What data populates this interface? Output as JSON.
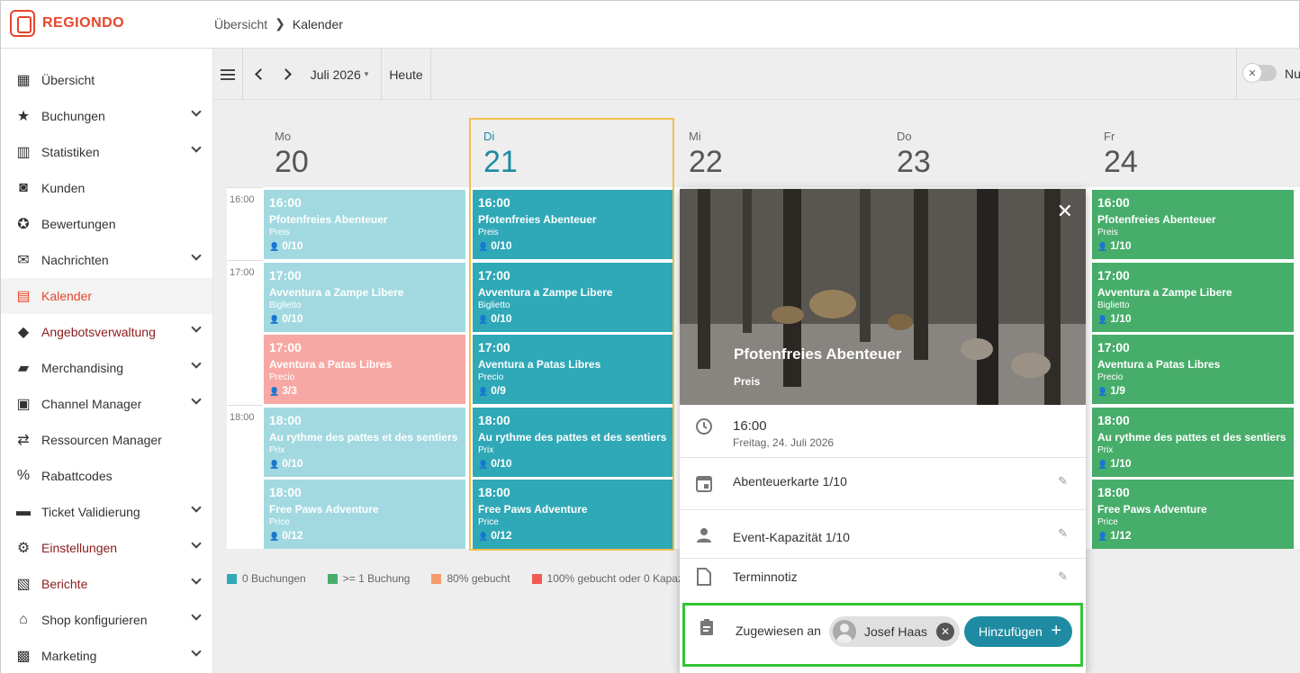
{
  "brand": {
    "name": "REGIONDO",
    "color": "#e8452c"
  },
  "breadcrumb": {
    "root": "Übersicht",
    "current": "Kalender"
  },
  "sidebar": {
    "items": [
      {
        "label": "Übersicht",
        "icon": "dashboard-icon",
        "glyph": "▦",
        "chevron": false,
        "state": ""
      },
      {
        "label": "Buchungen",
        "icon": "ticket-star-icon",
        "glyph": "★",
        "chevron": true,
        "state": ""
      },
      {
        "label": "Statistiken",
        "icon": "bar-chart-icon",
        "glyph": "▥",
        "chevron": true,
        "state": ""
      },
      {
        "label": "Kunden",
        "icon": "customer-icon",
        "glyph": "◙",
        "chevron": false,
        "state": ""
      },
      {
        "label": "Bewertungen",
        "icon": "star-badge-icon",
        "glyph": "✪",
        "chevron": false,
        "state": ""
      },
      {
        "label": "Nachrichten",
        "icon": "envelope-icon",
        "glyph": "✉",
        "chevron": true,
        "state": ""
      },
      {
        "label": "Kalender",
        "icon": "calendar-icon",
        "glyph": "▤",
        "chevron": false,
        "state": "active"
      },
      {
        "label": "Angebotsverwaltung",
        "icon": "tag-icon",
        "glyph": "◆",
        "chevron": true,
        "state": "red"
      },
      {
        "label": "Merchandising",
        "icon": "shopping-bag-icon",
        "glyph": "▰",
        "chevron": true,
        "state": ""
      },
      {
        "label": "Channel Manager",
        "icon": "channel-icon",
        "glyph": "▣",
        "chevron": true,
        "state": ""
      },
      {
        "label": "Ressourcen Manager",
        "icon": "sync-icon",
        "glyph": "⇄",
        "chevron": false,
        "state": ""
      },
      {
        "label": "Rabattcodes",
        "icon": "percent-icon",
        "glyph": "%",
        "chevron": false,
        "state": ""
      },
      {
        "label": "Ticket Validierung",
        "icon": "ticket-icon",
        "glyph": "▬",
        "chevron": true,
        "state": ""
      },
      {
        "label": "Einstellungen",
        "icon": "gear-icon",
        "glyph": "⚙",
        "chevron": true,
        "state": "red"
      },
      {
        "label": "Berichte",
        "icon": "report-icon",
        "glyph": "▧",
        "chevron": true,
        "state": "red"
      },
      {
        "label": "Shop konfigurieren",
        "icon": "store-icon",
        "glyph": "⌂",
        "chevron": true,
        "state": ""
      },
      {
        "label": "Marketing",
        "icon": "marketing-icon",
        "glyph": "▩",
        "chevron": true,
        "state": ""
      }
    ]
  },
  "toolbar": {
    "month": "Juli 2026",
    "today": "Heute",
    "toggle_label": "Nu"
  },
  "days": [
    {
      "name": "Mo",
      "num": "20",
      "today": false
    },
    {
      "name": "Di",
      "num": "21",
      "today": true
    },
    {
      "name": "Mi",
      "num": "22",
      "today": false
    },
    {
      "name": "Do",
      "num": "23",
      "today": false
    },
    {
      "name": "Fr",
      "num": "24",
      "today": false
    }
  ],
  "time_labels": [
    "16:00",
    "17:00",
    "18:00"
  ],
  "events": {
    "mo": [
      {
        "time": "16:00",
        "name": "Pfotenfreies Abenteuer",
        "price": "Preis",
        "cap": "0/10",
        "style": "light"
      },
      {
        "time": "17:00",
        "name": "Avventura a Zampe Libere",
        "price": "Biglietto",
        "cap": "0/10",
        "style": "light"
      },
      {
        "time": "17:00",
        "name": "Aventura a Patas Libres",
        "price": "Precio",
        "cap": "3/3",
        "style": "red"
      },
      {
        "time": "18:00",
        "name": "Au rythme des pattes et des sentiers",
        "price": "Prix",
        "cap": "0/10",
        "style": "light"
      },
      {
        "time": "18:00",
        "name": "Free Paws Adventure",
        "price": "Price",
        "cap": "0/12",
        "style": "light"
      }
    ],
    "di": [
      {
        "time": "16:00",
        "name": "Pfotenfreies Abenteuer",
        "price": "Preis",
        "cap": "0/10",
        "style": "dark"
      },
      {
        "time": "17:00",
        "name": "Avventura a Zampe Libere",
        "price": "Biglietto",
        "cap": "0/10",
        "style": "dark"
      },
      {
        "time": "17:00",
        "name": "Aventura a Patas Libres",
        "price": "Precio",
        "cap": "0/9",
        "style": "dark"
      },
      {
        "time": "18:00",
        "name": "Au rythme des pattes et des sentiers",
        "price": "Prix",
        "cap": "0/10",
        "style": "dark"
      },
      {
        "time": "18:00",
        "name": "Free Paws Adventure",
        "price": "Price",
        "cap": "0/12",
        "style": "dark"
      }
    ],
    "fr": [
      {
        "time": "16:00",
        "name": "Pfotenfreies Abenteuer",
        "price": "Preis",
        "cap": "1/10",
        "style": "green"
      },
      {
        "time": "17:00",
        "name": "Avventura a Zampe Libere",
        "price": "Biglietto",
        "cap": "1/10",
        "style": "green"
      },
      {
        "time": "17:00",
        "name": "Aventura a Patas Libres",
        "price": "Precio",
        "cap": "1/9",
        "style": "green"
      },
      {
        "time": "18:00",
        "name": "Au rythme des pattes et des sentiers",
        "price": "Prix",
        "cap": "1/10",
        "style": "green"
      },
      {
        "time": "18:00",
        "name": "Free Paws Adventure",
        "price": "Price",
        "cap": "1/12",
        "style": "green"
      }
    ]
  },
  "legend": [
    {
      "label": "0 Buchungen",
      "color": "#2fa8b7"
    },
    {
      "label": ">= 1 Buchung",
      "color": "#47ad6a"
    },
    {
      "label": "80% gebucht",
      "color": "#f59b6a"
    },
    {
      "label": "100% gebucht oder 0 Kapaz",
      "color": "#ef5a50"
    }
  ],
  "popup": {
    "title": "Pfotenfreies Abenteuer",
    "subtitle": "Preis",
    "time": "16:00",
    "date": "Freitag, 24. Juli 2026",
    "ticket": "Abenteuerkarte 1/10",
    "capacity": "Event-Kapazität 1/10",
    "note": "Terminnotiz",
    "assigned_label": "Zugewiesen an",
    "assignee": "Josef Haas",
    "add_label": "Hinzufügen"
  }
}
